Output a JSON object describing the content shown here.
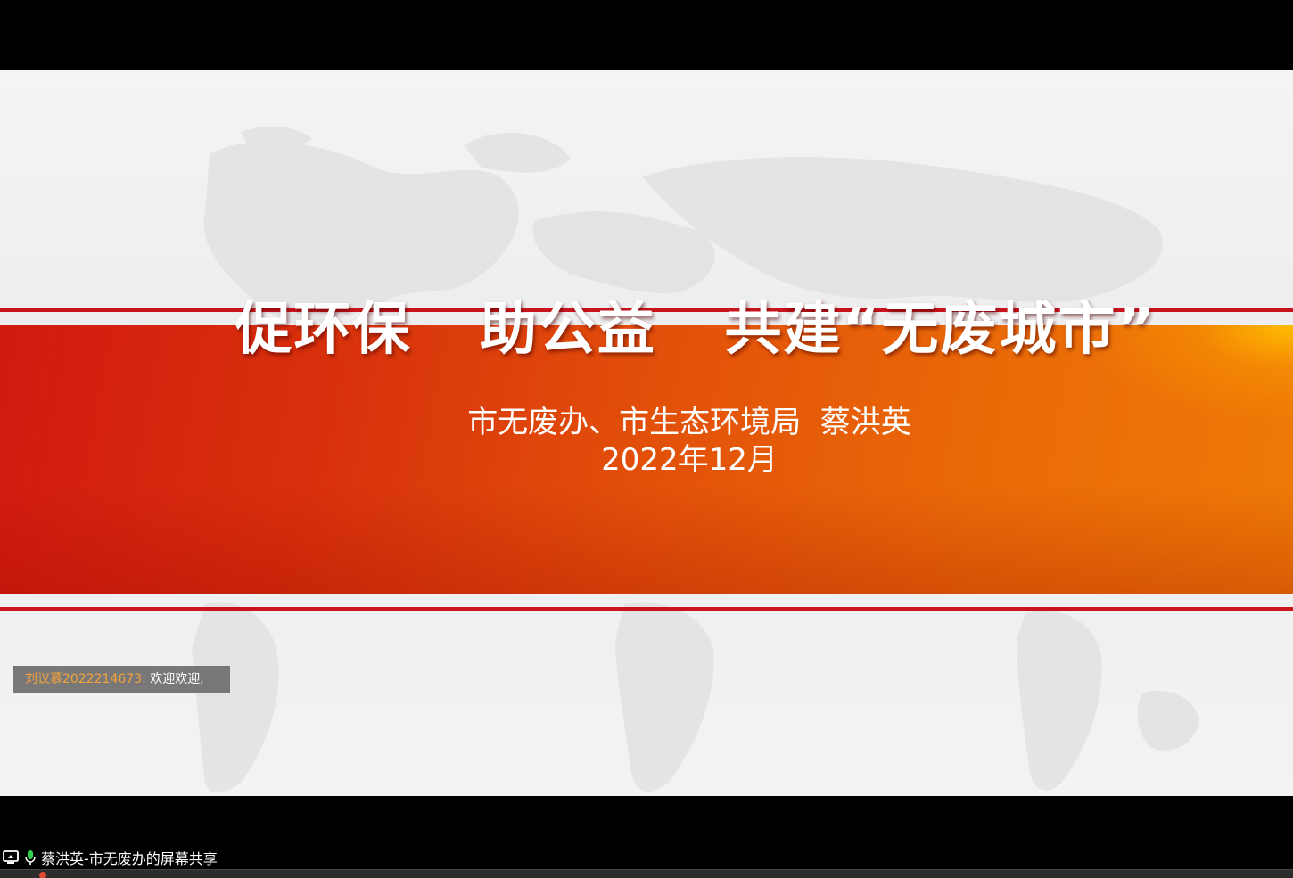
{
  "slide": {
    "title": "促环保  助公益  共建“无废城市”",
    "author": "市无废办、市生态环境局  蔡洪英",
    "date": "2022年12月"
  },
  "chat": {
    "sender": "刘议慕2022214673:",
    "message": " 欢迎欢迎,"
  },
  "status_bar": {
    "share_icon": "screen-share-icon",
    "mic_icon": "microphone-icon",
    "label": "蔡洪英-市无废办的屏幕共享"
  },
  "colors": {
    "banner_red": "#d21a10",
    "banner_orange": "#ee7a06",
    "rule_red": "#c8141c",
    "mic_green": "#2fcf4f",
    "chat_sender": "#f4a23c"
  }
}
